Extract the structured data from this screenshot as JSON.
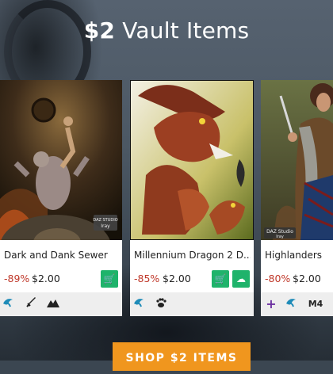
{
  "header": {
    "price_word": "$2",
    "rest_words": "Vault Items"
  },
  "products": [
    {
      "name": "Dark and Dank Sewer",
      "discount": "-89%",
      "price": "$2.00",
      "badge_line1": "DAZ STUDIO",
      "badge_line2": "Iray",
      "icons": [
        "genesis-icon",
        "sword-icon",
        "mountain-icon"
      ]
    },
    {
      "name": "Millennium Dragon 2 D...",
      "discount": "-85%",
      "price": "$2.00",
      "icons": [
        "genesis-icon",
        "paw-icon"
      ]
    },
    {
      "name": "Highlanders",
      "discount": "-80%",
      "price": "$2.00",
      "badge_line1": "DAZ Studio",
      "badge_line2": "Iray",
      "icons": [
        "plus-icon",
        "genesis-icon",
        "m4-icon"
      ],
      "m4_label": "M4"
    }
  ],
  "cta": {
    "label": "SHOP $2 ITEMS"
  },
  "colors": {
    "green": "#1fb36b",
    "discount": "#c0392b",
    "orange": "#f0961e",
    "plus": "#6b2fa0"
  }
}
